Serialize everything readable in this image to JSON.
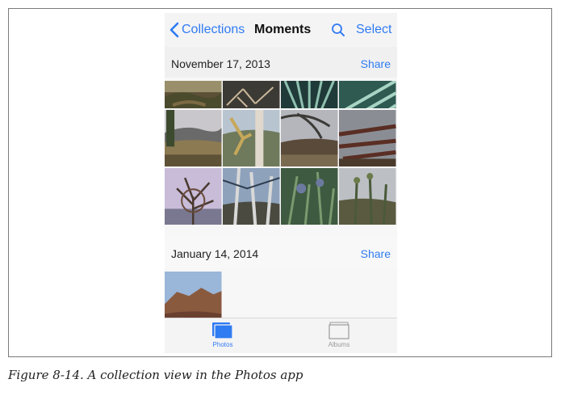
{
  "navbar": {
    "back_label": "Collections",
    "title": "Moments",
    "select_label": "Select"
  },
  "sections": [
    {
      "date": "November 17, 2013",
      "share_label": "Share"
    },
    {
      "date": "January 14, 2014",
      "share_label": "Share"
    }
  ],
  "tabbar": {
    "photos_label": "Photos",
    "albums_label": "Albums"
  },
  "caption": "Figure 8-14. A collection view in the Photos app",
  "colors": {
    "accent": "#2f7bf2",
    "inactive_tab": "#9a9a9a"
  },
  "icons": {
    "back": "chevron-left-icon",
    "search": "search-icon",
    "photos_tab": "photos-stack-icon",
    "albums_tab": "albums-stack-icon"
  }
}
